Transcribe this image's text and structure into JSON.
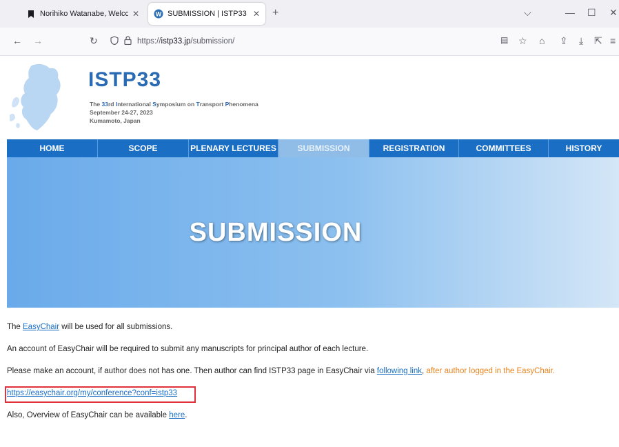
{
  "browser": {
    "tabs": [
      {
        "title": "Norihiko Watanabe, Welcome t",
        "icon": "bookmark-icon",
        "active": false
      },
      {
        "title": "SUBMISSION | ISTP33",
        "icon": "wordpress-icon",
        "active": true
      }
    ],
    "url_prefix": "https://",
    "url_host": "istp33.jp",
    "url_path": "/submission/"
  },
  "site": {
    "title": "ISTP33",
    "subtitle_parts": [
      "The ",
      "33",
      "rd ",
      "I",
      "nternational ",
      "S",
      "ymposium on ",
      "T",
      "ransport ",
      "P",
      "henomena"
    ],
    "dates": "September 24-27, 2023",
    "location": "Kumamoto, Japan"
  },
  "menu": [
    {
      "label": "HOME",
      "active": false
    },
    {
      "label": "SCOPE",
      "active": false
    },
    {
      "label": "PLENARY LECTURES",
      "active": false
    },
    {
      "label": "SUBMISSION",
      "active": true
    },
    {
      "label": "REGISTRATION",
      "active": false
    },
    {
      "label": "COMMITTEES",
      "active": false
    },
    {
      "label": "HISTORY",
      "active": false
    }
  ],
  "hero": {
    "title": "SUBMISSION"
  },
  "content": {
    "p1_before": "The ",
    "p1_link": "EasyChair",
    "p1_after": " will be used for all submissions.",
    "p2": "An account of EasyChair will be required to submit any manuscripts for principal author of each lecture.",
    "p3_before": "Please make an account, if author does not has one. Then author can find ISTP33 page in EasyChair via ",
    "p3_link": "following link",
    "p3_mid": ", ",
    "p3_orange": "after author logged in the EasyChair.",
    "url_link": "https://easychair.org/my/conference?conf=istp33",
    "p5_before": "Also, Overview of EasyChair can be available ",
    "p5_link": "here",
    "p5_after": "."
  },
  "colors": {
    "brand": "#2a6bb3",
    "menu": "#1a6fc4",
    "highlight": "#e0303a",
    "accent_text": "#e8821e"
  }
}
